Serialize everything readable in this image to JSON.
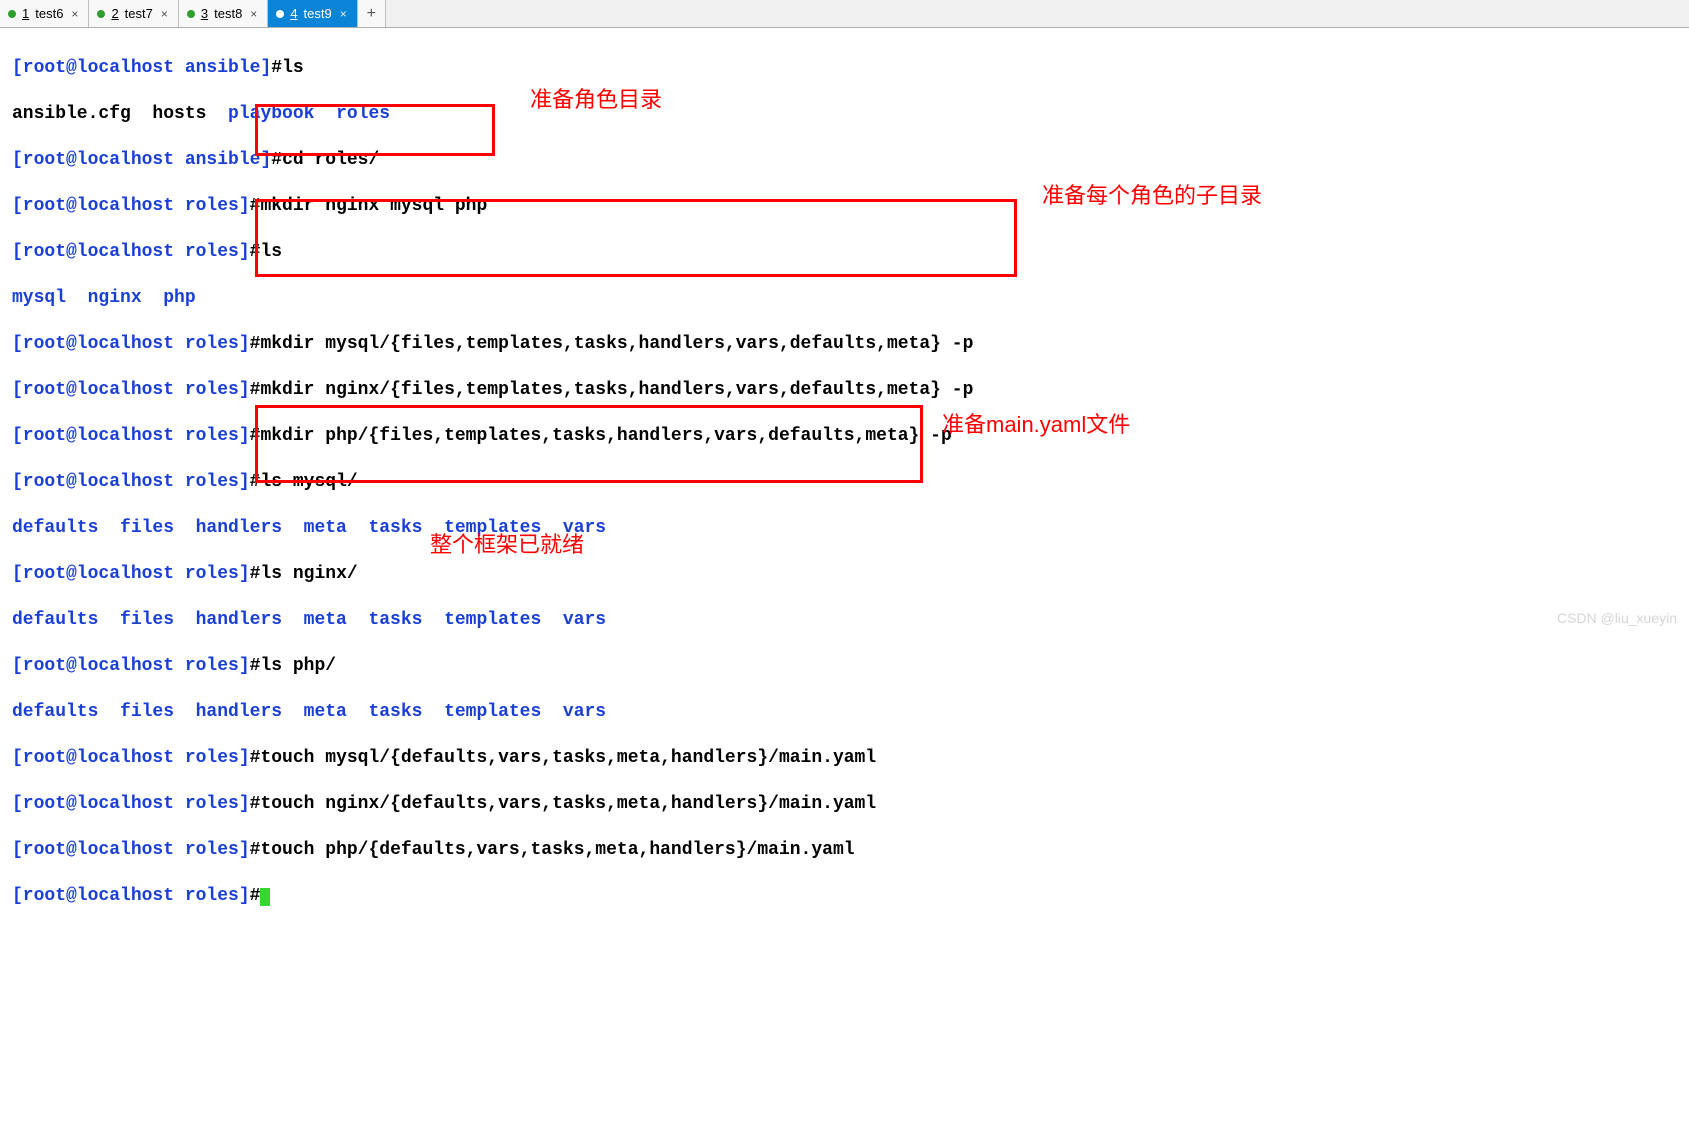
{
  "tabs": {
    "items": [
      {
        "num": "1",
        "label": "test6",
        "active": false
      },
      {
        "num": "2",
        "label": "test7",
        "active": false
      },
      {
        "num": "3",
        "label": "test8",
        "active": false
      },
      {
        "num": "4",
        "label": "test9",
        "active": true
      }
    ],
    "close_glyph": "×",
    "plus_glyph": "+"
  },
  "prompts": {
    "ansible": "[root@localhost ansible]",
    "roles": "[root@localhost roles]"
  },
  "commands": {
    "ls": "ls",
    "cd_roles": "cd roles/",
    "mkdir_roles": "mkdir nginx mysql php",
    "mkdir_mysql": "mkdir mysql/{files,templates,tasks,handlers,vars,defaults,meta} -p",
    "mkdir_nginx": "mkdir nginx/{files,templates,tasks,handlers,vars,defaults,meta} -p",
    "mkdir_php": "mkdir php/{files,templates,tasks,handlers,vars,defaults,meta} -p",
    "ls_mysql": "ls mysql/",
    "ls_nginx": "ls nginx/",
    "ls_php": "ls php/",
    "touch_mysql": "touch mysql/{defaults,vars,tasks,meta,handlers}/main.yaml",
    "touch_nginx": "touch nginx/{defaults,vars,tasks,meta,handlers}/main.yaml",
    "touch_php": "touch php/{defaults,vars,tasks,meta,handlers}/main.yaml"
  },
  "outputs": {
    "ansible_ls_plain": "ansible.cfg  hosts  ",
    "ansible_ls_dirs": "playbook  roles",
    "roles_ls": "mysql  nginx  php",
    "dir_listing": "defaults  files  handlers  meta  tasks  templates  vars"
  },
  "annotations": {
    "a1": "准备角色目录",
    "a2": "准备每个角色的子目录",
    "a3": "准备main.yaml文件",
    "a4": "整个框架已就绪"
  },
  "watermark": "CSDN @liu_xueyin",
  "hash": "#"
}
